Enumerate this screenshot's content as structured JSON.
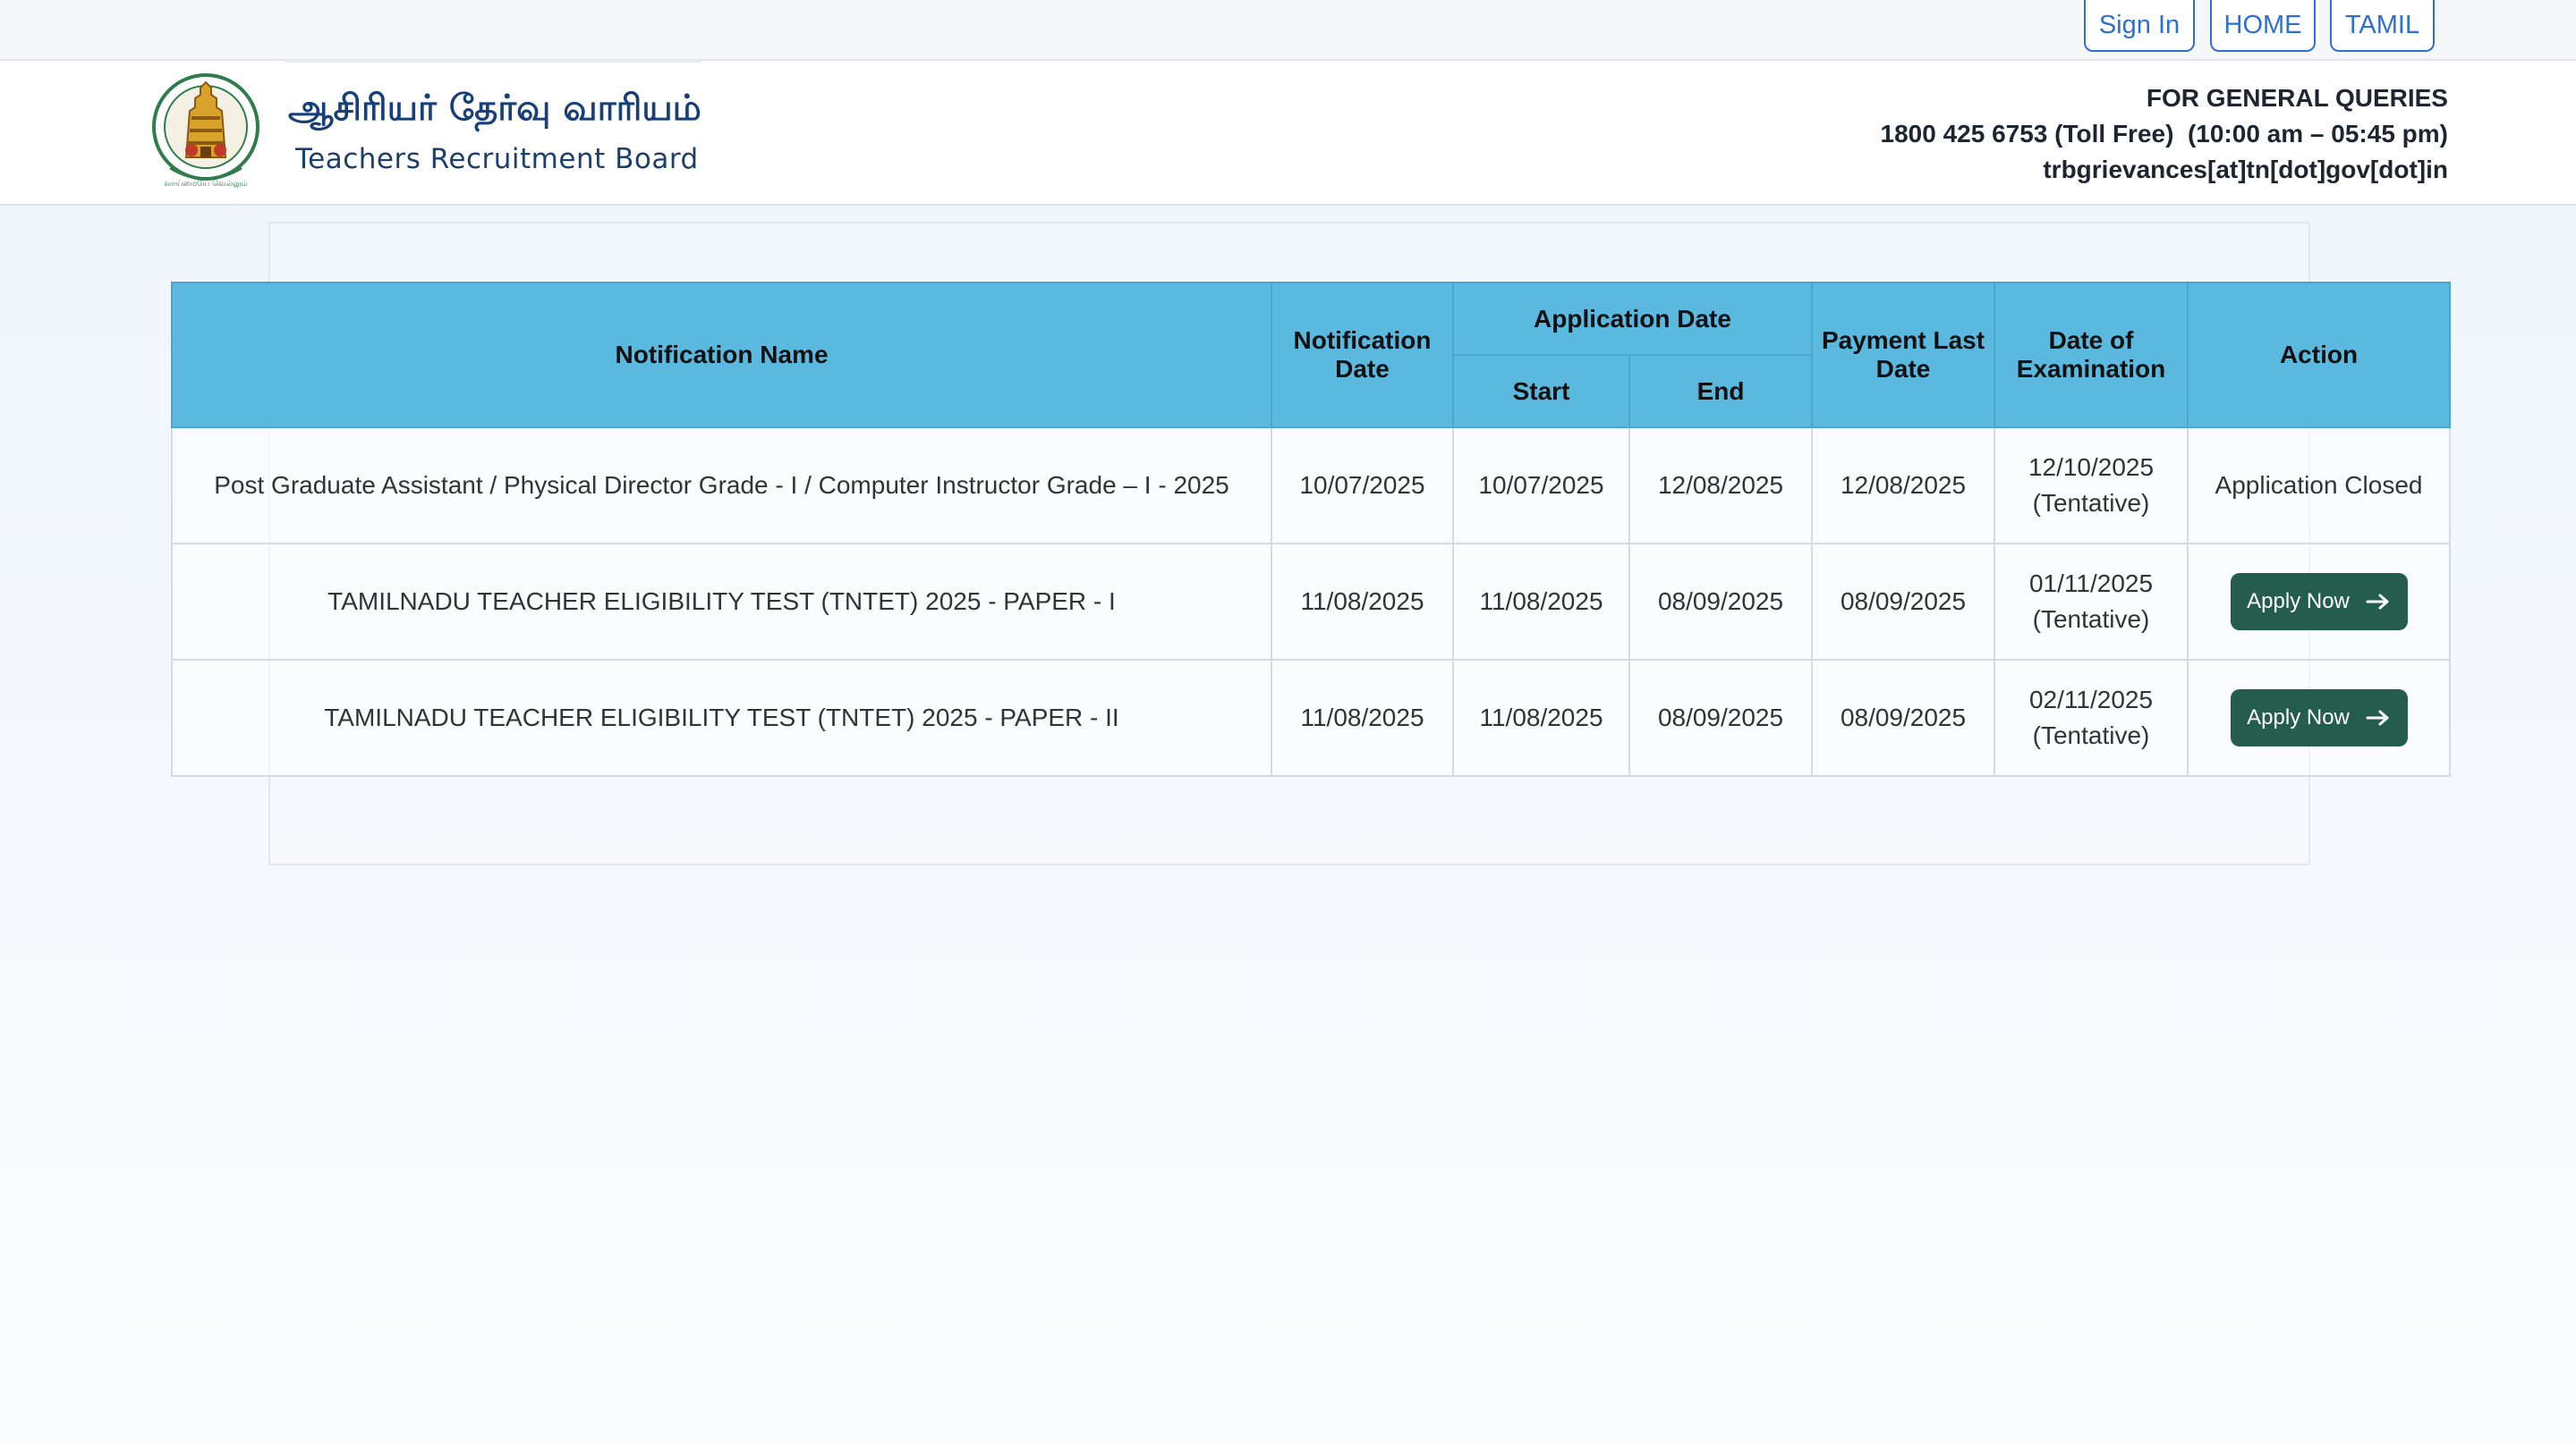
{
  "top_nav": {
    "sign_in": "Sign In",
    "home": "HOME",
    "language": "TAMIL"
  },
  "header": {
    "title_tamil": "ஆசிரியர் தேர்வு வாரியம்",
    "title_english": "Teachers Recruitment Board",
    "emblem_icon": "tamilnadu-emblem-icon",
    "queries": {
      "heading": "FOR GENERAL QUERIES",
      "phone": "1800 425 6753 (Toll Free)  (10:00 am – 05:45 pm)",
      "email": "trbgrievances[at]tn[dot]gov[dot]in"
    }
  },
  "table": {
    "headers": {
      "notification_name": "Notification Name",
      "notification_date": "Notification Date",
      "application_date": "Application Date",
      "start": "Start",
      "end": "End",
      "payment_last_date": "Payment Last Date",
      "date_of_examination": "Date of Examination",
      "action": "Action"
    },
    "rows": [
      {
        "name": "Post Graduate Assistant / Physical Director Grade - I / Computer Instructor Grade – I - 2025",
        "notification_date": "10/07/2025",
        "start": "10/07/2025",
        "end": "12/08/2025",
        "payment_last_date": "12/08/2025",
        "exam_date": "12/10/2025",
        "exam_note": "(Tentative)",
        "action": "Application Closed"
      },
      {
        "name": "TAMILNADU TEACHER ELIGIBILITY TEST (TNTET) 2025 - PAPER - I",
        "notification_date": "11/08/2025",
        "start": "11/08/2025",
        "end": "08/09/2025",
        "payment_last_date": "08/09/2025",
        "exam_date": "01/11/2025",
        "exam_note": "(Tentative)",
        "action": "Apply Now"
      },
      {
        "name": "TAMILNADU TEACHER ELIGIBILITY TEST (TNTET) 2025 - PAPER - II",
        "notification_date": "11/08/2025",
        "start": "11/08/2025",
        "end": "08/09/2025",
        "payment_last_date": "08/09/2025",
        "exam_date": "02/11/2025",
        "exam_note": "(Tentative)",
        "action": "Apply Now"
      }
    ]
  },
  "colors": {
    "header_blue": "#5bb9e0",
    "apply_green": "#245d4b",
    "link_blue": "#2d6fd2",
    "brand_navy": "#173f78"
  }
}
